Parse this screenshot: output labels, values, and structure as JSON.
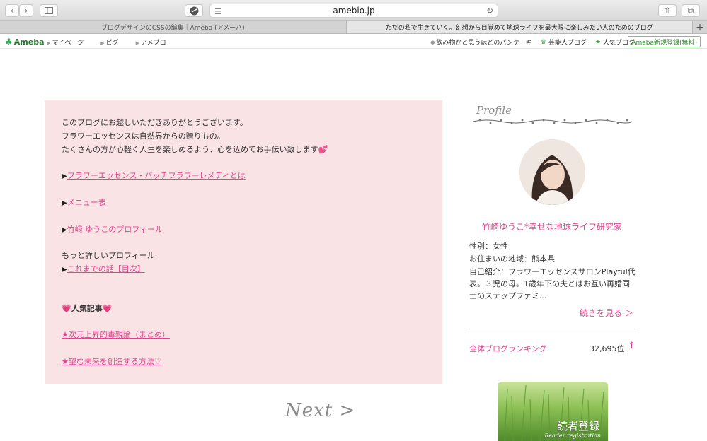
{
  "browser": {
    "url": "ameblo.jp",
    "tabs": [
      {
        "label": "ブログデザインのCSSの編集｜Ameba (アメーバ)",
        "active": false
      },
      {
        "label": "ただの私で生きていく。幻想から目覚めて地球ライフを最大限に楽しみたい人のためのブログ",
        "active": true
      }
    ],
    "new_tab": "+"
  },
  "ameba_bar": {
    "logo": "Ameba",
    "nav": [
      "マイページ",
      "ピグ",
      "アメブロ"
    ],
    "right": [
      "飲み物かと思うほどのパンケーキ",
      "芸能人ブログ",
      "人気ブログ"
    ],
    "register": "Ameba新規登録(無料)"
  },
  "main": {
    "intro": [
      "このブログにお越しいただきありがとうございます。",
      "フラワーエッセンスは自然界からの贈りもの。",
      "たくさんの方が心軽く人生を楽しめるよう、心を込めてお手伝い致します"
    ],
    "link_essence": "フラワーエッセンス・バッチフラワーレメディとは",
    "link_menu": "メニュー表",
    "link_profile": "竹﨑 ゆうこのプロフィール",
    "more_profile": "もっと詳しいプロフィール",
    "link_story": "これまでの話【目次】",
    "popular_title": "人気記事",
    "popular_1": "★次元上昇的毒親論（まとめ）",
    "popular_2": "★望む未来を創造する方法♡",
    "next": "Next >"
  },
  "sidebar": {
    "profile_heading": "Profile",
    "name": "竹崎ゆうこ*幸せな地球ライフ研究家",
    "gender": "性別：女性",
    "residence": "お住まいの地域：熊本県",
    "intro_1": "自己紹介：フラワーエッセンスサロンPlayful代",
    "intro_2": "表。３児の母。1歳年下の夫とはお互い再婚同",
    "intro_3": "士のステップファミ...",
    "read_more": "続きを見る ＞",
    "ranking_label": "全体ブログランキング",
    "ranking_value": "32,695位",
    "ranking_arrow": "↑",
    "reader_title": "読者登録",
    "reader_sub": "Reader registration"
  },
  "colors": {
    "accent_pink": "#e0448e",
    "box_bg": "#fae3e5",
    "ameba_green": "#2fa84f"
  }
}
